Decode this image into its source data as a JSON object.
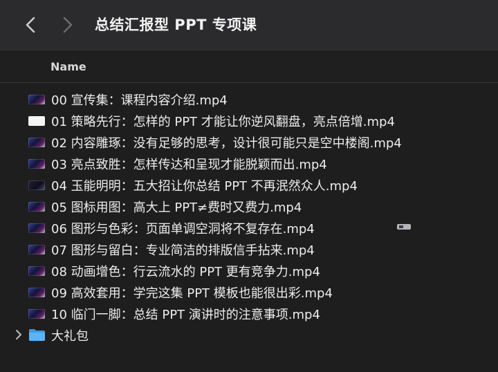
{
  "window": {
    "title": "总结汇报型 PPT 专项课"
  },
  "header": {
    "name_label": "Name"
  },
  "files": [
    {
      "name": "00 宣传集：课程内容介绍.mp4",
      "thumb": "video"
    },
    {
      "name": "01 策略先行：怎样的 PPT 才能让你逆风翻盘，亮点倍增.mp4",
      "thumb": "white"
    },
    {
      "name": "02 内容雕琢：没有足够的思考，设计很可能只是空中楼阁.mp4",
      "thumb": "video"
    },
    {
      "name": "03 亮点致胜：怎样传达和呈现才能脱颖而出.mp4",
      "thumb": "video"
    },
    {
      "name": "04 玉能明明：五大招让你总结 PPT 不再泯然众人.mp4",
      "thumb": "dark"
    },
    {
      "name": "05 图标用图：高大上 PPT≠费时又费力.mp4",
      "thumb": "video"
    },
    {
      "name": "06 图形与色彩：页面单调空洞将不复存在.mp4",
      "thumb": "video"
    },
    {
      "name": "07 图形与留白：专业简洁的排版信手拈来.mp4",
      "thumb": "video"
    },
    {
      "name": "08 动画增色：行云流水的 PPT 更有竞争力.mp4",
      "thumb": "video"
    },
    {
      "name": "09 高效套用：学完这集 PPT 模板也能很出彩.mp4",
      "thumb": "video"
    },
    {
      "name": "10 临门一脚：总结 PPT 演讲时的注意事项.mp4",
      "thumb": "video"
    }
  ],
  "folder": {
    "name": "大礼包"
  },
  "colors": {
    "toolbar": "#2b2a2c",
    "background": "#1e1e1f",
    "folder": "#4aa6f2",
    "text": "#ededed"
  },
  "icons": {
    "back": "chevron-left-icon",
    "forward": "chevron-right-icon",
    "disclosure": "chevron-right-icon",
    "folder": "folder-icon",
    "video": "video-file-icon"
  }
}
